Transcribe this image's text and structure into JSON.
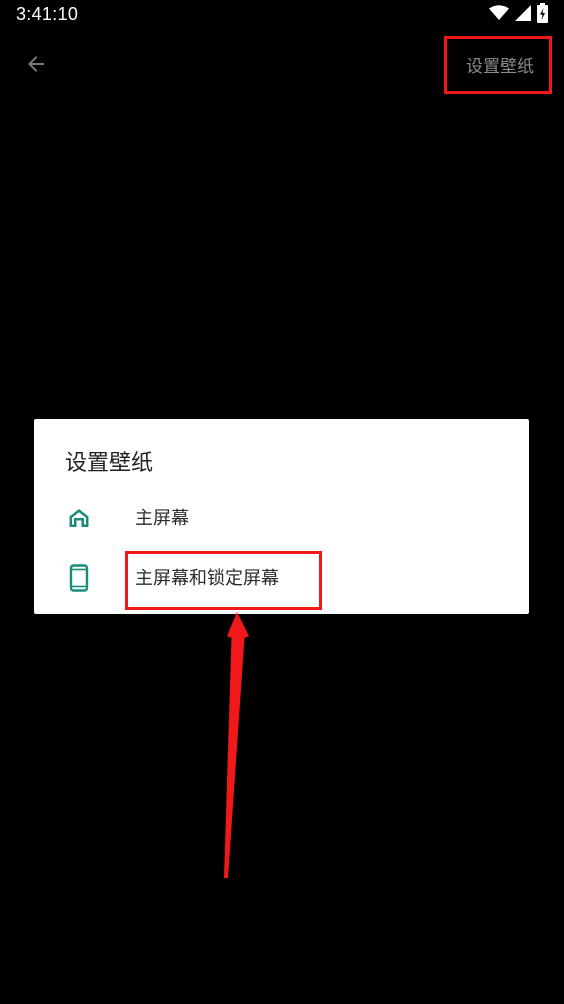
{
  "status_bar": {
    "time": "3:41:10",
    "icons": [
      "wifi-icon",
      "signal-icon",
      "battery-charging-icon"
    ]
  },
  "app_bar": {
    "back_icon": "arrow-back-icon",
    "action_label": "设置壁纸"
  },
  "dialog": {
    "title": "设置壁纸",
    "options": [
      {
        "label": "主屏幕",
        "icon": "home-icon"
      },
      {
        "label": "主屏幕和锁定屏幕",
        "icon": "phone-icon"
      }
    ]
  },
  "colors": {
    "background": "#000000",
    "dialog_bg": "#ffffff",
    "icon_accent": "#1a8c7e",
    "annotation_red": "#f01818",
    "action_text": "#8a8a8a"
  }
}
